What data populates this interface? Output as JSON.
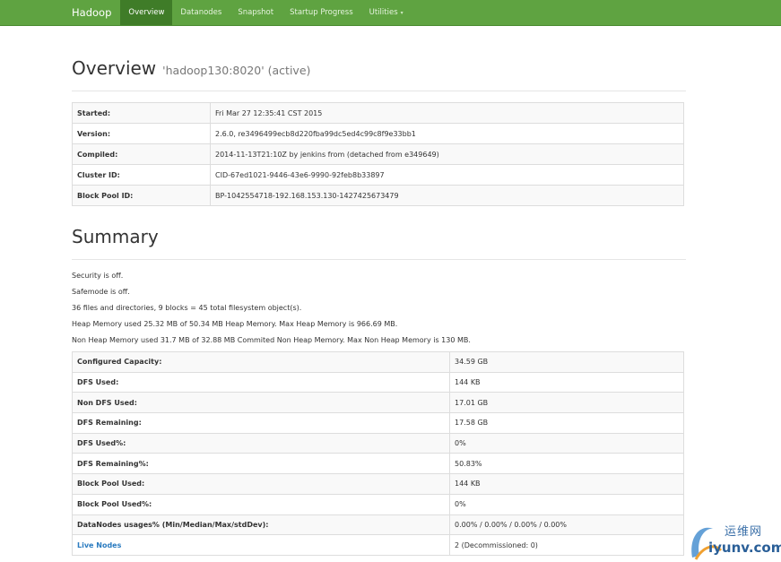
{
  "navbar": {
    "brand": "Hadoop",
    "items": [
      {
        "label": "Overview",
        "active": true
      },
      {
        "label": "Datanodes",
        "active": false
      },
      {
        "label": "Snapshot",
        "active": false
      },
      {
        "label": "Startup Progress",
        "active": false
      },
      {
        "label": "Utilities",
        "active": false,
        "dropdown": true
      }
    ],
    "caret": "▾",
    "color": "#5fa341"
  },
  "overview": {
    "title": "Overview",
    "subtitle": "'hadoop130:8020' (active)",
    "rows": [
      {
        "key": "Started:",
        "value": "Fri Mar 27 12:35:41 CST 2015"
      },
      {
        "key": "Version:",
        "value": "2.6.0, re3496499ecb8d220fba99dc5ed4c99c8f9e33bb1"
      },
      {
        "key": "Compiled:",
        "value": "2014-11-13T21:10Z by jenkins from (detached from e349649)"
      },
      {
        "key": "Cluster ID:",
        "value": "CID-67ed1021-9446-43e6-9990-92feb8b33897"
      },
      {
        "key": "Block Pool ID:",
        "value": "BP-1042554718-192.168.153.130-1427425673479"
      }
    ]
  },
  "summary": {
    "title": "Summary",
    "lines": [
      "Security is off.",
      "Safemode is off.",
      "36 files and directories, 9 blocks = 45 total filesystem object(s).",
      "Heap Memory used 25.32 MB of 50.34 MB Heap Memory. Max Heap Memory is 966.69 MB.",
      "Non Heap Memory used 31.7 MB of 32.88 MB Commited Non Heap Memory. Max Non Heap Memory is 130 MB."
    ],
    "rows": [
      {
        "key": "Configured Capacity:",
        "value": "34.59 GB"
      },
      {
        "key": "DFS Used:",
        "value": "144 KB"
      },
      {
        "key": "Non DFS Used:",
        "value": "17.01 GB"
      },
      {
        "key": "DFS Remaining:",
        "value": "17.58 GB"
      },
      {
        "key": "DFS Used%:",
        "value": "0%"
      },
      {
        "key": "DFS Remaining%:",
        "value": "50.83%"
      },
      {
        "key": "Block Pool Used:",
        "value": "144 KB"
      },
      {
        "key": "Block Pool Used%:",
        "value": "0%"
      },
      {
        "key": "DataNodes usages% (Min/Median/Max/stdDev):",
        "value": "0.00% / 0.00% / 0.00% / 0.00%"
      },
      {
        "key": "Live Nodes",
        "value": "2 (Decommissioned: 0)",
        "link": true
      }
    ]
  },
  "watermark": {
    "cn": "运维网",
    "en": "iyunv.com"
  }
}
